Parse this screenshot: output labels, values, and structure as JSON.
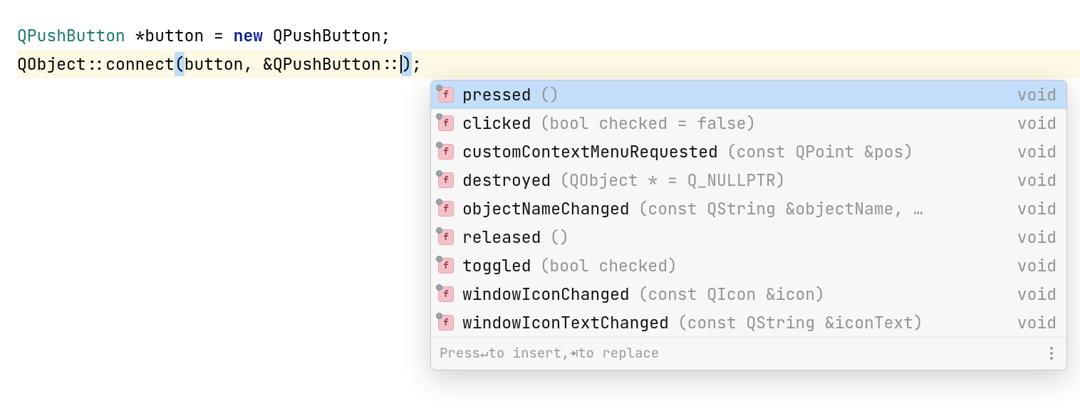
{
  "code": {
    "line1": {
      "type1": "QPushButton",
      "star": " *",
      "ident": "button",
      "assign": " = ",
      "kw_new": "new",
      "space": " ",
      "type2": "QPushButton",
      "semi": ";"
    },
    "line2": {
      "cls": "QObject",
      "scope1": "::",
      "fn": "connect",
      "lparen": "(",
      "arg1": "button",
      "comma": ", ",
      "amp": "&",
      "argtype": "QPushButton",
      "scope2": "::",
      "rparen": ")",
      "semi": ";"
    }
  },
  "popup": {
    "items": [
      {
        "name": "pressed",
        "params": "()",
        "ret": "void",
        "selected": true
      },
      {
        "name": "clicked",
        "params": "(bool checked = false)",
        "ret": "void",
        "selected": false
      },
      {
        "name": "customContextMenuRequested",
        "params": "(const QPoint &pos)",
        "ret": "void",
        "selected": false
      },
      {
        "name": "destroyed",
        "params": "(QObject * = Q_NULLPTR)",
        "ret": "void",
        "selected": false
      },
      {
        "name": "objectNameChanged",
        "params": "(const QString &objectName, …",
        "ret": "void",
        "selected": false
      },
      {
        "name": "released",
        "params": "()",
        "ret": "void",
        "selected": false
      },
      {
        "name": "toggled",
        "params": "(bool checked)",
        "ret": "void",
        "selected": false
      },
      {
        "name": "windowIconChanged",
        "params": "(const QIcon &icon)",
        "ret": "void",
        "selected": false
      },
      {
        "name": "windowIconTextChanged",
        "params": "(const QString &iconText)",
        "ret": "void",
        "selected": false
      }
    ],
    "icon_letter": "f",
    "footer": {
      "press": "Press ",
      "enter": "↵",
      "insert": " to insert, ",
      "tab": "⇥",
      "replace": " to replace"
    }
  }
}
